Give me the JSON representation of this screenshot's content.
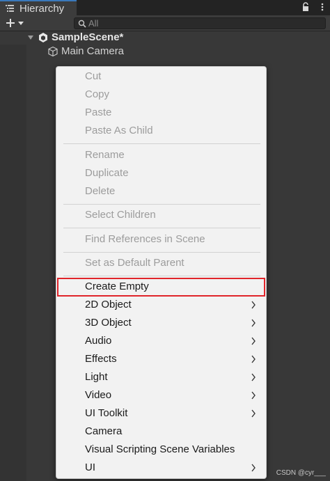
{
  "window": {
    "tab_title": "Hierarchy"
  },
  "search": {
    "placeholder": "All"
  },
  "tree": {
    "scene_name": "SampleScene*",
    "items": [
      {
        "label": "Main Camera"
      }
    ]
  },
  "context_menu": {
    "items": [
      {
        "label": "Cut",
        "enabled": false
      },
      {
        "label": "Copy",
        "enabled": false
      },
      {
        "label": "Paste",
        "enabled": false
      },
      {
        "label": "Paste As Child",
        "enabled": false
      },
      {
        "label": "Rename",
        "enabled": false
      },
      {
        "label": "Duplicate",
        "enabled": false
      },
      {
        "label": "Delete",
        "enabled": false
      },
      {
        "label": "Select Children",
        "enabled": false
      },
      {
        "label": "Find References in Scene",
        "enabled": false
      },
      {
        "label": "Set as Default Parent",
        "enabled": false
      },
      {
        "label": "Create Empty",
        "enabled": true,
        "submenu": false,
        "highlighted": true
      },
      {
        "label": "2D Object",
        "enabled": true,
        "submenu": true
      },
      {
        "label": "3D Object",
        "enabled": true,
        "submenu": true
      },
      {
        "label": "Audio",
        "enabled": true,
        "submenu": true
      },
      {
        "label": "Effects",
        "enabled": true,
        "submenu": true
      },
      {
        "label": "Light",
        "enabled": true,
        "submenu": true
      },
      {
        "label": "Video",
        "enabled": true,
        "submenu": true
      },
      {
        "label": "UI Toolkit",
        "enabled": true,
        "submenu": true
      },
      {
        "label": "Camera",
        "enabled": true,
        "submenu": false
      },
      {
        "label": "Visual Scripting Scene Variables",
        "enabled": true,
        "submenu": false
      },
      {
        "label": "UI",
        "enabled": true,
        "submenu": true
      }
    ]
  },
  "colors": {
    "highlight_border": "#e0242a",
    "tab_accent": "#3a79bb"
  },
  "watermark": "CSDN @cyr___"
}
